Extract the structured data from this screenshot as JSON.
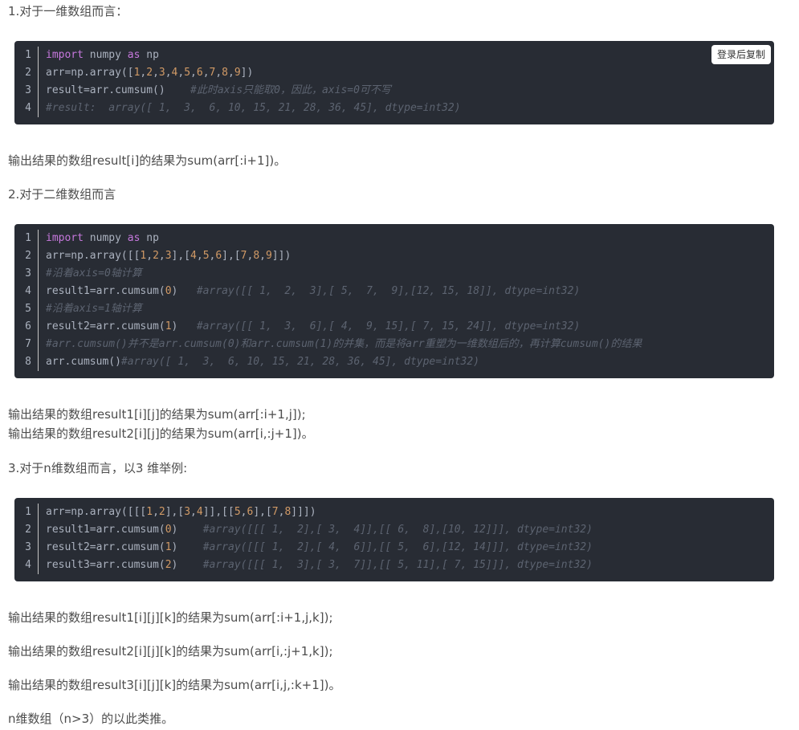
{
  "section1": {
    "heading": "1.对于一维数组而言：",
    "copy_label": "登录后复制",
    "code": [
      {
        "n": "1",
        "parts": [
          {
            "t": "import",
            "c": "kw"
          },
          {
            "t": " numpy "
          },
          {
            "t": "as",
            "c": "kw"
          },
          {
            "t": " np"
          }
        ]
      },
      {
        "n": "2",
        "parts": [
          {
            "t": "arr=np.array(["
          },
          {
            "t": "1",
            "c": "num"
          },
          {
            "t": ","
          },
          {
            "t": "2",
            "c": "num"
          },
          {
            "t": ","
          },
          {
            "t": "3",
            "c": "num"
          },
          {
            "t": ","
          },
          {
            "t": "4",
            "c": "num"
          },
          {
            "t": ","
          },
          {
            "t": "5",
            "c": "num"
          },
          {
            "t": ","
          },
          {
            "t": "6",
            "c": "num"
          },
          {
            "t": ","
          },
          {
            "t": "7",
            "c": "num"
          },
          {
            "t": ","
          },
          {
            "t": "8",
            "c": "num"
          },
          {
            "t": ","
          },
          {
            "t": "9",
            "c": "num"
          },
          {
            "t": "])"
          }
        ]
      },
      {
        "n": "3",
        "parts": [
          {
            "t": "result=arr.cumsum()    "
          },
          {
            "t": "#此时axis只能取0，因此，axis=0可不写",
            "c": "cm"
          }
        ]
      },
      {
        "n": "4",
        "parts": [
          {
            "t": "#result:  array([ 1,  3,  6, 10, 15, 21, 28, 36, 45], dtype=int32)",
            "c": "cm"
          }
        ]
      }
    ],
    "result_text": "输出结果的数组result[i]的结果为sum(arr[:i+1])。"
  },
  "section2": {
    "heading": "2.对于二维数组而言",
    "code": [
      {
        "n": "1",
        "parts": [
          {
            "t": "import",
            "c": "kw"
          },
          {
            "t": " numpy "
          },
          {
            "t": "as",
            "c": "kw"
          },
          {
            "t": " np"
          }
        ]
      },
      {
        "n": "2",
        "parts": [
          {
            "t": "arr=np.array([["
          },
          {
            "t": "1",
            "c": "num"
          },
          {
            "t": ","
          },
          {
            "t": "2",
            "c": "num"
          },
          {
            "t": ","
          },
          {
            "t": "3",
            "c": "num"
          },
          {
            "t": "],["
          },
          {
            "t": "4",
            "c": "num"
          },
          {
            "t": ","
          },
          {
            "t": "5",
            "c": "num"
          },
          {
            "t": ","
          },
          {
            "t": "6",
            "c": "num"
          },
          {
            "t": "],["
          },
          {
            "t": "7",
            "c": "num"
          },
          {
            "t": ","
          },
          {
            "t": "8",
            "c": "num"
          },
          {
            "t": ","
          },
          {
            "t": "9",
            "c": "num"
          },
          {
            "t": "]])"
          }
        ]
      },
      {
        "n": "3",
        "parts": [
          {
            "t": "#沿着axis=0轴计算",
            "c": "cm"
          }
        ]
      },
      {
        "n": "4",
        "parts": [
          {
            "t": "result1=arr.cumsum("
          },
          {
            "t": "0",
            "c": "num"
          },
          {
            "t": ")   "
          },
          {
            "t": "#array([[ 1,  2,  3],[ 5,  7,  9],[12, 15, 18]], dtype=int32)",
            "c": "cm"
          }
        ]
      },
      {
        "n": "5",
        "parts": [
          {
            "t": "#沿着axis=1轴计算",
            "c": "cm"
          }
        ]
      },
      {
        "n": "6",
        "parts": [
          {
            "t": "result2=arr.cumsum("
          },
          {
            "t": "1",
            "c": "num"
          },
          {
            "t": ")   "
          },
          {
            "t": "#array([[ 1,  3,  6],[ 4,  9, 15],[ 7, 15, 24]], dtype=int32)",
            "c": "cm"
          }
        ]
      },
      {
        "n": "7",
        "parts": [
          {
            "t": "#arr.cumsum()并不是arr.cumsum(0)和arr.cumsum(1)的并集，而是将arr重塑为一维数组后的，再计算cumsum()的结果",
            "c": "cm"
          }
        ]
      },
      {
        "n": "8",
        "parts": [
          {
            "t": "arr.cumsum()"
          },
          {
            "t": "#array([ 1,  3,  6, 10, 15, 21, 28, 36, 45], dtype=int32)",
            "c": "cm"
          }
        ]
      }
    ],
    "result_lines": [
      "输出结果的数组result1[i][j]的结果为sum(arr[:i+1,j]);",
      "输出结果的数组result2[i][j]的结果为sum(arr[i,:j+1])。"
    ]
  },
  "section3": {
    "heading": "3.对于n维数组而言，以3 维举例:",
    "code": [
      {
        "n": "1",
        "parts": [
          {
            "t": "arr=np.array([[["
          },
          {
            "t": "1",
            "c": "num"
          },
          {
            "t": ","
          },
          {
            "t": "2",
            "c": "num"
          },
          {
            "t": "],["
          },
          {
            "t": "3",
            "c": "num"
          },
          {
            "t": ","
          },
          {
            "t": "4",
            "c": "num"
          },
          {
            "t": "]],[["
          },
          {
            "t": "5",
            "c": "num"
          },
          {
            "t": ","
          },
          {
            "t": "6",
            "c": "num"
          },
          {
            "t": "],["
          },
          {
            "t": "7",
            "c": "num"
          },
          {
            "t": ","
          },
          {
            "t": "8",
            "c": "num"
          },
          {
            "t": "]]])"
          }
        ]
      },
      {
        "n": "2",
        "parts": [
          {
            "t": "result1=arr.cumsum("
          },
          {
            "t": "0",
            "c": "num"
          },
          {
            "t": ")    "
          },
          {
            "t": "#array([[[ 1,  2],[ 3,  4]],[[ 6,  8],[10, 12]]], dtype=int32)",
            "c": "cm"
          }
        ]
      },
      {
        "n": "3",
        "parts": [
          {
            "t": "result2=arr.cumsum("
          },
          {
            "t": "1",
            "c": "num"
          },
          {
            "t": ")    "
          },
          {
            "t": "#array([[[ 1,  2],[ 4,  6]],[[ 5,  6],[12, 14]]], dtype=int32)",
            "c": "cm"
          }
        ]
      },
      {
        "n": "4",
        "parts": [
          {
            "t": "result3=arr.cumsum("
          },
          {
            "t": "2",
            "c": "num"
          },
          {
            "t": ")    "
          },
          {
            "t": "#array([[[ 1,  3],[ 3,  7]],[[ 5, 11],[ 7, 15]]], dtype=int32)",
            "c": "cm"
          }
        ]
      }
    ],
    "result1": "输出结果的数组result1[i][j][k]的结果为sum(arr[:i+1,j,k]);",
    "result2": "输出结果的数组result2[i][j][k]的结果为sum(arr[i,:j+1,k]);",
    "result3": "输出结果的数组result3[i][j][k]的结果为sum(arr[i,j,:k+1])。"
  },
  "conclusion": "n维数组（n>3）的以此类推。"
}
